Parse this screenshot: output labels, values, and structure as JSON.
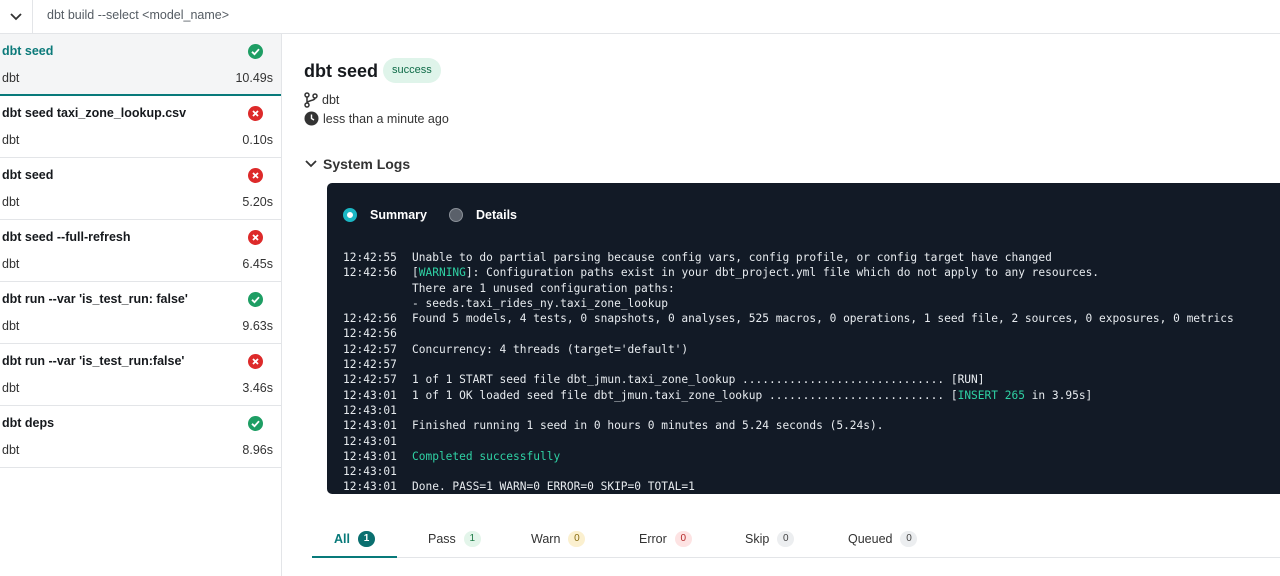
{
  "topbar": {
    "command": "dbt build --select <model_name>"
  },
  "runs": [
    {
      "name": "dbt seed",
      "project": "dbt",
      "duration": "10.49s",
      "status": "success"
    },
    {
      "name": "dbt seed taxi_zone_lookup.csv",
      "project": "dbt",
      "duration": "0.10s",
      "status": "error"
    },
    {
      "name": "dbt seed",
      "project": "dbt",
      "duration": "5.20s",
      "status": "error"
    },
    {
      "name": "dbt seed --full-refresh",
      "project": "dbt",
      "duration": "6.45s",
      "status": "error"
    },
    {
      "name": "dbt run --var 'is_test_run: false'",
      "project": "dbt",
      "duration": "9.63s",
      "status": "success"
    },
    {
      "name": "dbt run --var 'is_test_run:false'",
      "project": "dbt",
      "duration": "3.46s",
      "status": "error"
    },
    {
      "name": "dbt deps",
      "project": "dbt",
      "duration": "8.96s",
      "status": "success"
    }
  ],
  "detail": {
    "title": "dbt seed",
    "status_badge": "success",
    "branch": "dbt",
    "time": "less than a minute ago",
    "logs_heading": "System Logs",
    "view_summary": "Summary",
    "view_details": "Details"
  },
  "log_lines": [
    {
      "ts": "12:42:55",
      "msg": "Unable to do partial parsing because config vars, config profile, or config target have changed"
    },
    {
      "ts": "12:42:56",
      "pre": "[",
      "hl": "WARNING",
      "post": "]: Configuration paths exist in your dbt_project.yml file which do not apply to any resources."
    },
    {
      "ts": "",
      "msg": "There are 1 unused configuration paths:"
    },
    {
      "ts": "",
      "msg": "- seeds.taxi_rides_ny.taxi_zone_lookup"
    },
    {
      "ts": "12:42:56",
      "msg": "Found 5 models, 4 tests, 0 snapshots, 0 analyses, 525 macros, 0 operations, 1 seed file, 2 sources, 0 exposures, 0 metrics"
    },
    {
      "ts": "12:42:56",
      "msg": ""
    },
    {
      "ts": "12:42:57",
      "msg": "Concurrency: 4 threads (target='default')"
    },
    {
      "ts": "12:42:57",
      "msg": ""
    },
    {
      "ts": "12:42:57",
      "msg": "1 of 1 START seed file dbt_jmun.taxi_zone_lookup .............................. [RUN]"
    },
    {
      "ts": "12:43:01",
      "pre": "1 of 1 OK loaded seed file dbt_jmun.taxi_zone_lookup .......................... [",
      "hl": "INSERT 265",
      "post": " in 3.95s]"
    },
    {
      "ts": "12:43:01",
      "msg": ""
    },
    {
      "ts": "12:43:01",
      "msg": "Finished running 1 seed in 0 hours 0 minutes and 5.24 seconds (5.24s)."
    },
    {
      "ts": "12:43:01",
      "msg": ""
    },
    {
      "ts": "12:43:01",
      "pre": "",
      "hl": "Completed successfully",
      "post": ""
    },
    {
      "ts": "12:43:01",
      "msg": ""
    },
    {
      "ts": "12:43:01",
      "msg": "Done. PASS=1 WARN=0 ERROR=0 SKIP=0 TOTAL=1"
    }
  ],
  "filters": [
    {
      "label": "All",
      "count": "1",
      "bg": "#0a6f6f",
      "fg": "#ffffff"
    },
    {
      "label": "Pass",
      "count": "1",
      "bg": "#e3f5ea",
      "fg": "#1d7a45"
    },
    {
      "label": "Warn",
      "count": "0",
      "bg": "#fbf0cf",
      "fg": "#8a6d12"
    },
    {
      "label": "Error",
      "count": "0",
      "bg": "#fde3e3",
      "fg": "#b42828"
    },
    {
      "label": "Skip",
      "count": "0",
      "bg": "#eceef0",
      "fg": "#444"
    },
    {
      "label": "Queued",
      "count": "0",
      "bg": "#eceef0",
      "fg": "#444"
    }
  ],
  "colors": {
    "success": "#1e9e64",
    "error": "#dd2a2a",
    "accent": "#087a7a",
    "console_bg": "#121a26",
    "highlight": "#2fd1a4"
  },
  "icons": {
    "toggle": "chevron-down-icon",
    "branch": "git-branch-icon",
    "time": "clock-icon",
    "logs": "chevron-down-icon"
  }
}
